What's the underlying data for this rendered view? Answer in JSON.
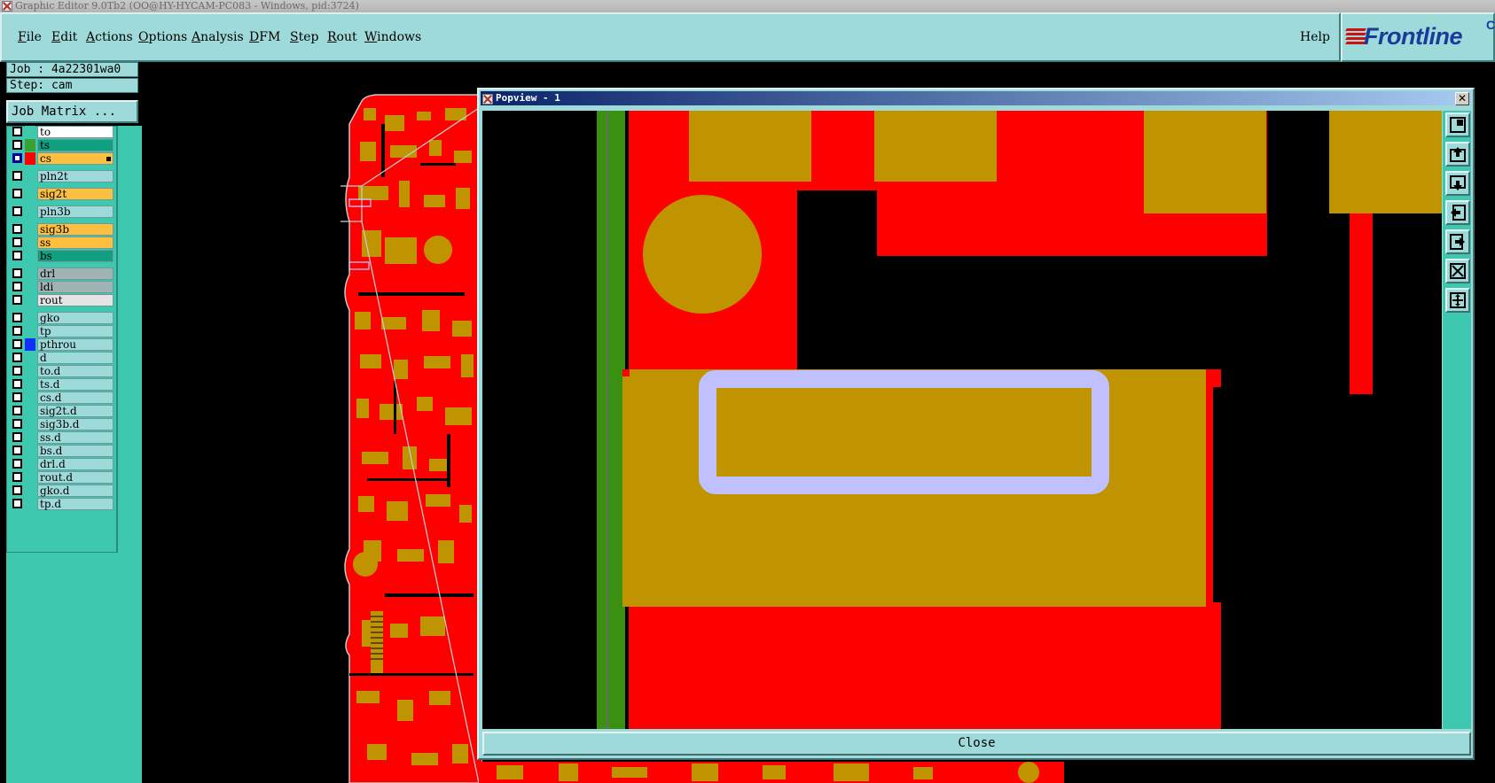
{
  "window": {
    "title": "Graphic Editor 9.0Tb2 (OO@HY-HYCAM-PC083 - Windows, pid:3724)"
  },
  "menu": {
    "items": [
      "File",
      "Edit",
      "Actions",
      "Options",
      "Analysis",
      "DFM",
      "Step",
      "Rout",
      "Windows"
    ],
    "help": "Help"
  },
  "logo": {
    "text": "Frontline",
    "suffix": "C"
  },
  "job": {
    "job_label": "Job : 4a22301wa0",
    "step_label": "Step: cam",
    "matrix_button": "Job Matrix ..."
  },
  "layers": [
    {
      "name": "to",
      "color": "#ffffff",
      "swatch": "#3fc8b0",
      "checked": false
    },
    {
      "name": "ts",
      "color": "#10a080",
      "swatch": "#3aa030",
      "checked": false
    },
    {
      "name": "cs",
      "color": "#ffc040",
      "swatch": "#ff0000",
      "checked": true,
      "active": true
    },
    {
      "name": "pln2t",
      "color": "#9fdada",
      "swatch": "#3fc8b0",
      "checked": false
    },
    {
      "name": "sig2t",
      "color": "#ffc040",
      "swatch": "#3fc8b0",
      "checked": false
    },
    {
      "name": "pln3b",
      "color": "#9fdada",
      "swatch": "#3fc8b0",
      "checked": false
    },
    {
      "name": "sig3b",
      "color": "#ffc040",
      "swatch": "#3fc8b0",
      "checked": false
    },
    {
      "name": "ss",
      "color": "#ffc040",
      "swatch": "#3fc8b0",
      "checked": false
    },
    {
      "name": "bs",
      "color": "#10a080",
      "swatch": "#3fc8b0",
      "checked": false
    },
    {
      "name": "drl",
      "color": "#a0b4b4",
      "swatch": "#3fc8b0",
      "checked": false
    },
    {
      "name": "ldi",
      "color": "#a0b4b4",
      "swatch": "#3fc8b0",
      "checked": false
    },
    {
      "name": "rout",
      "color": "#e4e4e4",
      "swatch": "#3fc8b0",
      "checked": false
    },
    {
      "name": "gko",
      "color": "#9fdada",
      "swatch": "#3fc8b0",
      "checked": false
    },
    {
      "name": "tp",
      "color": "#9fdada",
      "swatch": "#3fc8b0",
      "checked": false
    },
    {
      "name": "pthrou",
      "color": "#9fdada",
      "swatch": "#1030ff",
      "checked": false
    },
    {
      "name": "d",
      "color": "#9fdada",
      "swatch": "#3fc8b0",
      "checked": false
    },
    {
      "name": "to.d",
      "color": "#9fdada",
      "swatch": "#3fc8b0",
      "checked": false
    },
    {
      "name": "ts.d",
      "color": "#9fdada",
      "swatch": "#3fc8b0",
      "checked": false
    },
    {
      "name": "cs.d",
      "color": "#9fdada",
      "swatch": "#3fc8b0",
      "checked": false
    },
    {
      "name": "sig2t.d",
      "color": "#9fdada",
      "swatch": "#3fc8b0",
      "checked": false
    },
    {
      "name": "sig3b.d",
      "color": "#9fdada",
      "swatch": "#3fc8b0",
      "checked": false
    },
    {
      "name": "ss.d",
      "color": "#9fdada",
      "swatch": "#3fc8b0",
      "checked": false
    },
    {
      "name": "bs.d",
      "color": "#9fdada",
      "swatch": "#3fc8b0",
      "checked": false
    },
    {
      "name": "drl.d",
      "color": "#9fdada",
      "swatch": "#3fc8b0",
      "checked": false
    },
    {
      "name": "rout.d",
      "color": "#9fdada",
      "swatch": "#3fc8b0",
      "checked": false
    },
    {
      "name": "gko.d",
      "color": "#9fdada",
      "swatch": "#3fc8b0",
      "checked": false
    },
    {
      "name": "tp.d",
      "color": "#9fdada",
      "swatch": "#3fc8b0",
      "checked": false
    }
  ],
  "popview": {
    "title": "Popview - 1",
    "close_button": "Close",
    "tools": [
      "zoom-fit-icon",
      "pan-up-icon",
      "pan-down-icon",
      "pan-left-icon",
      "pan-right-icon",
      "zoom-home-icon",
      "zoom-center-icon"
    ]
  },
  "colors": {
    "panel": "#9fdada",
    "panel_dark": "#3fc8b0",
    "copper": "#ff0000",
    "pad": "#bf9400",
    "highlight": "#c0c0ff",
    "trace_green": "#3a9010"
  }
}
